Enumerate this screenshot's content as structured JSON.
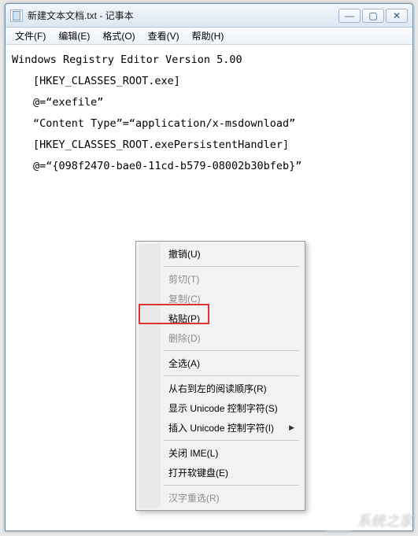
{
  "window": {
    "title": "新建文本文档.txt - 记事本"
  },
  "winbuttons": {
    "min": "—",
    "max": "▢",
    "close": "✕"
  },
  "menubar": {
    "file": "文件(F)",
    "edit": "编辑(E)",
    "format": "格式(O)",
    "view": "查看(V)",
    "help": "帮助(H)"
  },
  "editor": {
    "line1": "Windows Registry Editor Version 5.00",
    "line2": "　　[HKEY_CLASSES_ROOT.exe]",
    "line3": "　　@=“exefile”",
    "line4": "　　“Content Type”=“application/x-msdownload”",
    "line5": "　　[HKEY_CLASSES_ROOT.exePersistentHandler]",
    "line6": "　　@=“{098f2470-bae0-11cd-b579-08002b30bfeb}”"
  },
  "context_menu": {
    "undo": "撤销(U)",
    "cut": "剪切(T)",
    "copy": "复制(C)",
    "paste": "粘贴(P)",
    "delete": "删除(D)",
    "selectall": "全选(A)",
    "rtl": "从右到左的阅读顺序(R)",
    "showuni": "显示 Unicode 控制字符(S)",
    "insuni": "插入 Unicode 控制字符(I)",
    "closeime": "关闭 IME(L)",
    "softkb": "打开软键盘(E)",
    "hanzi": "汉字重选(R)"
  },
  "watermark": {
    "text": "系统之家"
  }
}
